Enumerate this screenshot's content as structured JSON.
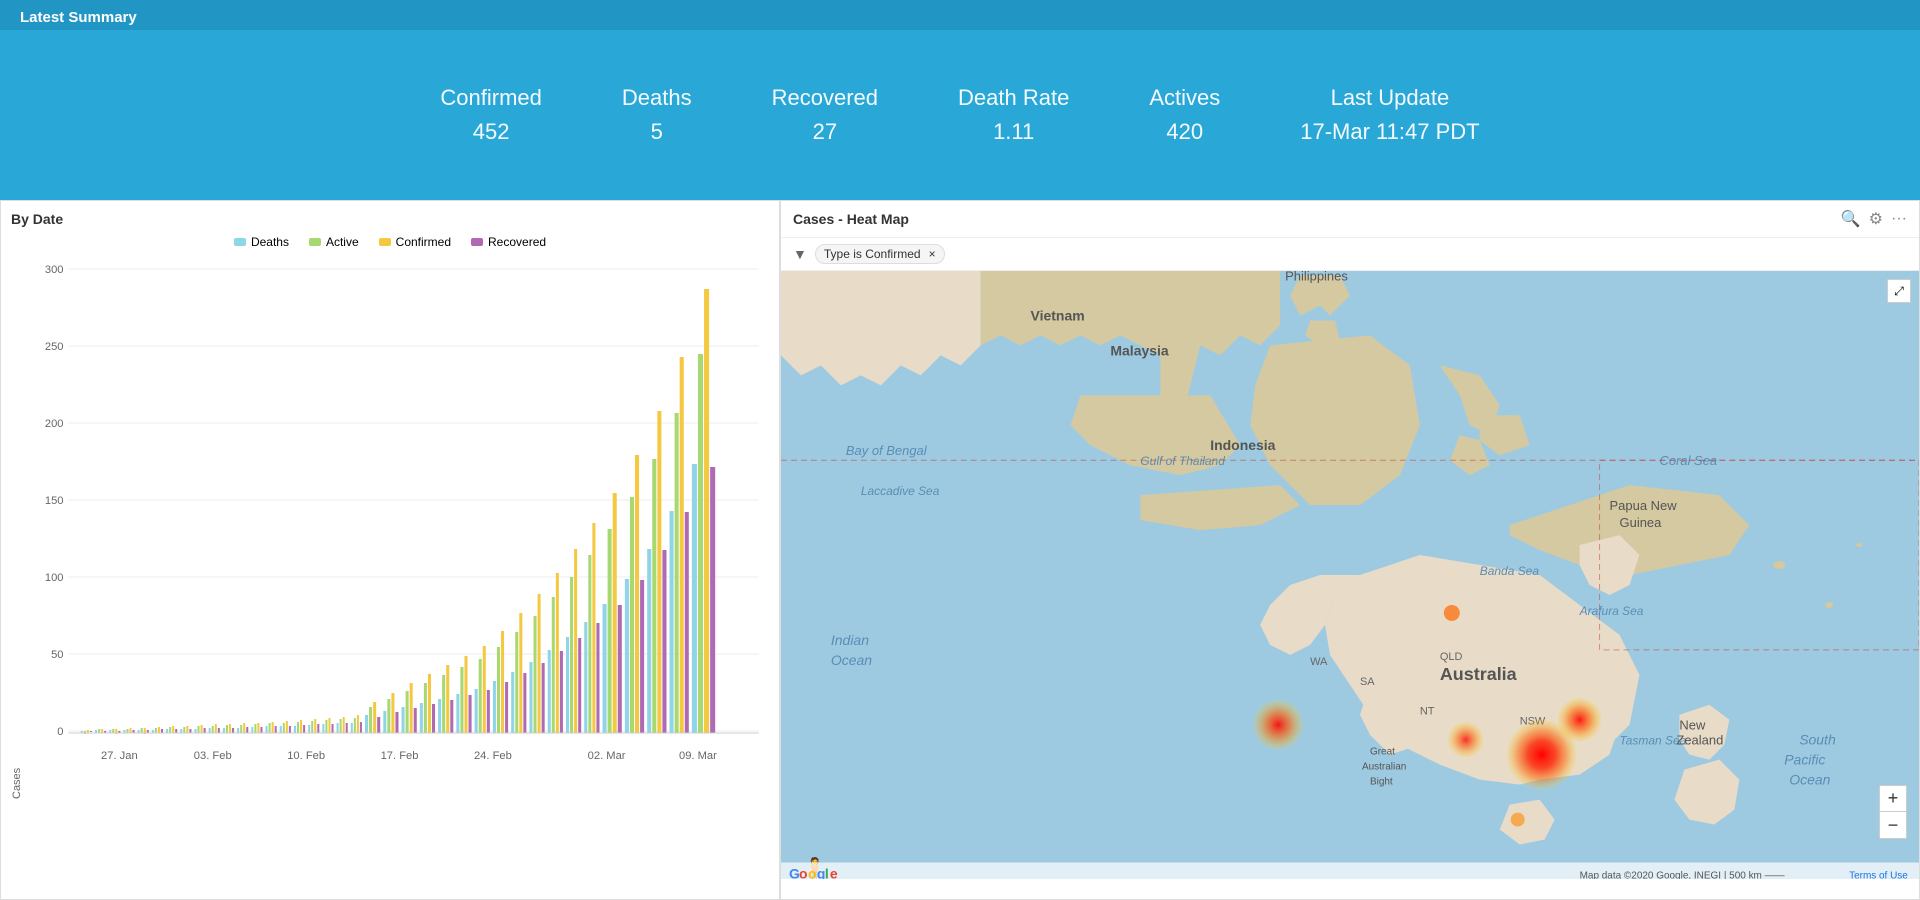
{
  "header": {
    "title": "Latest Summary"
  },
  "stats": [
    {
      "id": "confirmed",
      "label": "Confirmed",
      "value": "452"
    },
    {
      "id": "deaths",
      "label": "Deaths",
      "value": "5"
    },
    {
      "id": "recovered",
      "label": "Recovered",
      "value": "27"
    },
    {
      "id": "death_rate",
      "label": "Death Rate",
      "value": "1.11"
    },
    {
      "id": "actives",
      "label": "Actives",
      "value": "420"
    },
    {
      "id": "last_update",
      "label": "Last Update",
      "value": "17-Mar 11:47 PDT"
    }
  ],
  "chart": {
    "title": "By Date",
    "y_axis_label": "Cases",
    "legend": [
      {
        "id": "deaths",
        "label": "Deaths",
        "color": "#90d4e8"
      },
      {
        "id": "active",
        "label": "Active",
        "color": "#a8d870"
      },
      {
        "id": "confirmed",
        "label": "Confirmed",
        "color": "#f5c842"
      },
      {
        "id": "recovered",
        "label": "Recovered",
        "color": "#b06ab3"
      }
    ],
    "x_labels": [
      "27. Jan",
      "03. Feb",
      "10. Feb",
      "17. Feb",
      "24. Feb",
      "02. Mar",
      "09. Mar"
    ],
    "y_labels": [
      "0",
      "50",
      "100",
      "150",
      "200",
      "250",
      "300"
    ]
  },
  "map": {
    "title": "Cases - Heat Map",
    "filter_label": "Type is Confirmed",
    "filter_close": "×",
    "zoom_in": "+",
    "zoom_out": "−",
    "attribution": "Map data ©2020 Google, INEGI | 500 km",
    "terms": "Terms of Use"
  }
}
